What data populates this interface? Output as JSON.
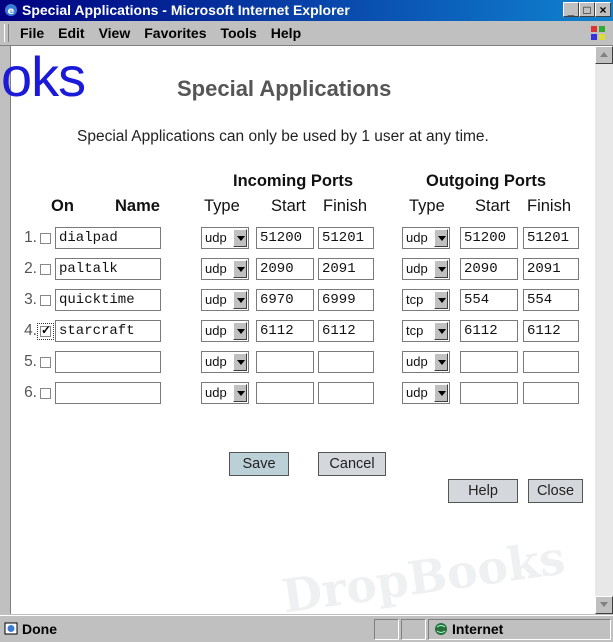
{
  "window": {
    "title": "Special Applications - Microsoft Internet Explorer"
  },
  "menu": [
    "File",
    "Edit",
    "View",
    "Favorites",
    "Tools",
    "Help"
  ],
  "watermark": {
    "top": "oks",
    "bottom": "DropBooks"
  },
  "page": {
    "heading": "Special Applications",
    "subtitle": "Special Applications can only be used by 1 user at any time."
  },
  "table": {
    "incoming_label": "Incoming Ports",
    "outgoing_label": "Outgoing Ports",
    "col_on": "On",
    "col_name": "Name",
    "col_type": "Type",
    "col_start": "Start",
    "col_finish": "Finish",
    "rows": [
      {
        "num": "1.",
        "checked": false,
        "name": "dialpad",
        "in_type": "udp",
        "in_start": "51200",
        "in_finish": "51201",
        "out_type": "udp",
        "out_start": "51200",
        "out_finish": "51201"
      },
      {
        "num": "2.",
        "checked": false,
        "name": "paltalk",
        "in_type": "udp",
        "in_start": "2090",
        "in_finish": "2091",
        "out_type": "udp",
        "out_start": "2090",
        "out_finish": "2091"
      },
      {
        "num": "3.",
        "checked": false,
        "name": "quicktime",
        "in_type": "udp",
        "in_start": "6970",
        "in_finish": "6999",
        "out_type": "tcp",
        "out_start": "554",
        "out_finish": "554"
      },
      {
        "num": "4.",
        "checked": true,
        "name": "starcraft",
        "in_type": "udp",
        "in_start": "6112",
        "in_finish": "6112",
        "out_type": "tcp",
        "out_start": "6112",
        "out_finish": "6112"
      },
      {
        "num": "5.",
        "checked": false,
        "name": "",
        "in_type": "udp",
        "in_start": "",
        "in_finish": "",
        "out_type": "udp",
        "out_start": "",
        "out_finish": ""
      },
      {
        "num": "6.",
        "checked": false,
        "name": "",
        "in_type": "udp",
        "in_start": "",
        "in_finish": "",
        "out_type": "udp",
        "out_start": "",
        "out_finish": ""
      }
    ]
  },
  "buttons": {
    "save": "Save",
    "cancel": "Cancel",
    "help": "Help",
    "close": "Close"
  },
  "status": {
    "text": "Done",
    "zone": "Internet"
  }
}
